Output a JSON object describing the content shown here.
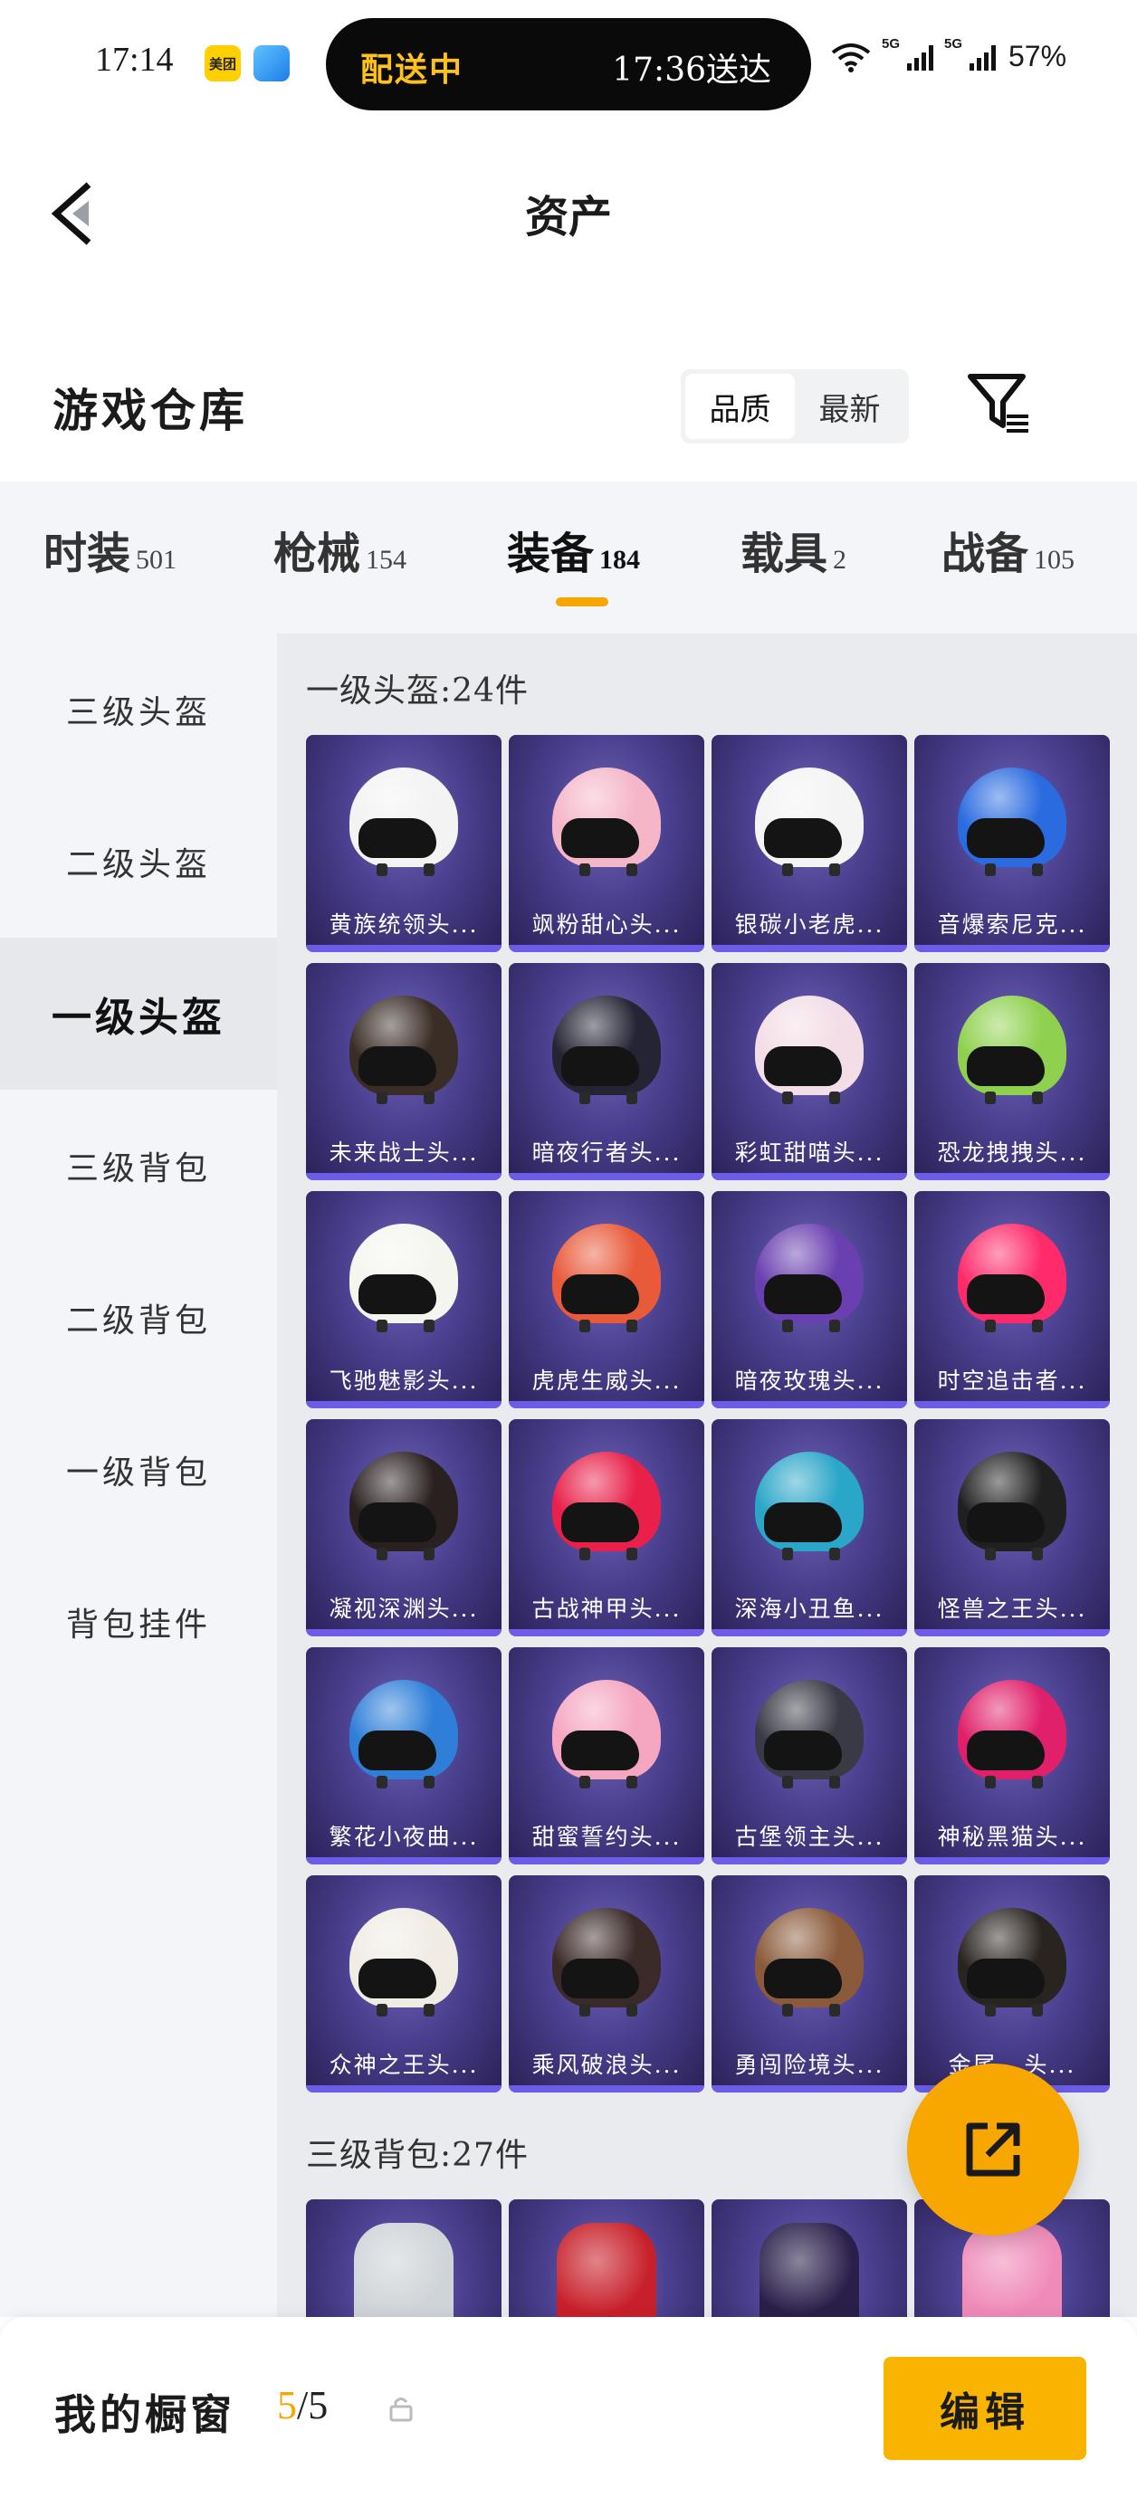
{
  "status_bar": {
    "time": "17:14",
    "app_icon_1_text": "美团",
    "delivery_status": "配送中",
    "delivery_eta": "17:36送达",
    "network_1": "5G",
    "network_2": "5G",
    "battery": "57%"
  },
  "header": {
    "title": "资产"
  },
  "warehouse": {
    "title": "游戏仓库",
    "sort_options": [
      "品质",
      "最新"
    ],
    "sort_selected": "品质"
  },
  "tabs": [
    {
      "label": "时装",
      "count": "501"
    },
    {
      "label": "枪械",
      "count": "154"
    },
    {
      "label": "装备",
      "count": "184",
      "active": true
    },
    {
      "label": "载具",
      "count": "2"
    },
    {
      "label": "战备",
      "count": "105"
    }
  ],
  "sidebar": {
    "items": [
      "三级头盔",
      "二级头盔",
      "一级头盔",
      "三级背包",
      "二级背包",
      "一级背包",
      "背包挂件"
    ],
    "active": "一级头盔"
  },
  "sections": [
    {
      "title": "一级头盔:24件",
      "items": [
        "黄族统领头...",
        "飒粉甜心头...",
        "银碳小老虎...",
        "音爆索尼克...",
        "未来战士头...",
        "暗夜行者头...",
        "彩虹甜喵头...",
        "恐龙拽拽头...",
        "飞驰魅影头...",
        "虎虎生威头...",
        "暗夜玫瑰头...",
        "时空追击者...",
        "凝视深渊头...",
        "古战神甲头...",
        "深海小丑鱼...",
        "怪兽之王头...",
        "繁花小夜曲...",
        "甜蜜誓约头...",
        "古堡领主头...",
        "神秘黑猫头...",
        "众神之王头...",
        "乘风破浪头...",
        "勇闯险境头...",
        "金尾...头..."
      ]
    },
    {
      "title": "三级背包:27件"
    }
  ],
  "bottom_bar": {
    "showcase_label": "我的橱窗",
    "showcase_current": "5",
    "showcase_total": "/5",
    "edit_label": "编辑"
  },
  "colors": {
    "accent": "#f5a700",
    "card_bg": "#4a3f8e",
    "edit_button": "#f8b400"
  }
}
